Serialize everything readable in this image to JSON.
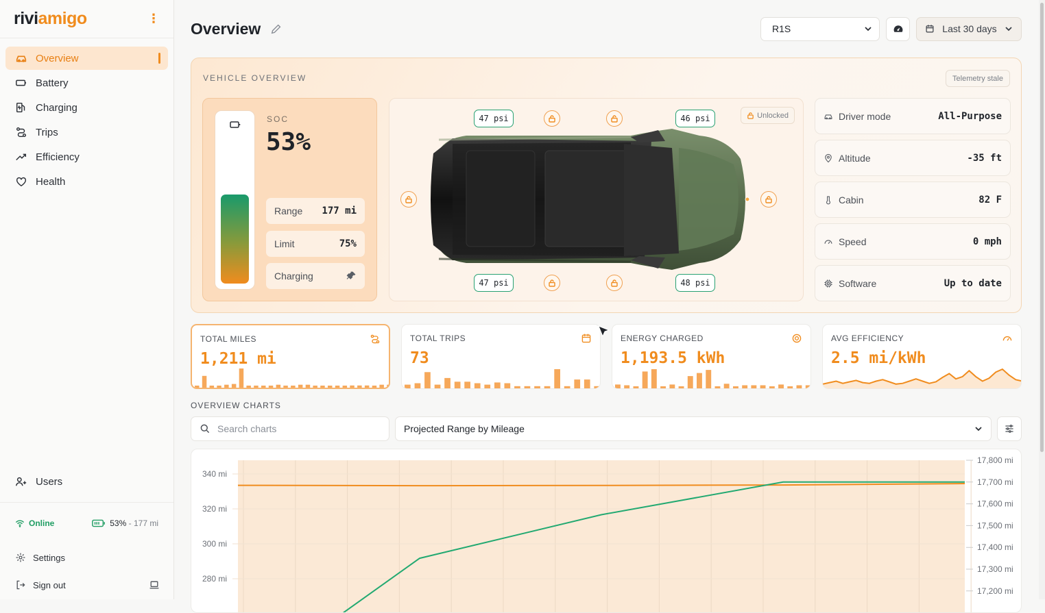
{
  "app": {
    "logo_a": "rivi",
    "logo_b": "amigo"
  },
  "sidebar": {
    "items": [
      {
        "label": "Overview",
        "icon": "car-icon"
      },
      {
        "label": "Battery",
        "icon": "battery-icon"
      },
      {
        "label": "Charging",
        "icon": "fuel-pump-icon"
      },
      {
        "label": "Trips",
        "icon": "route-icon"
      },
      {
        "label": "Efficiency",
        "icon": "trend-up-icon"
      },
      {
        "label": "Health",
        "icon": "heart-icon"
      }
    ],
    "users_label": "Users",
    "status": {
      "online": "Online",
      "soc": "53%",
      "sep": "-",
      "range": "177 mi"
    },
    "settings_label": "Settings",
    "signout_label": "Sign out"
  },
  "header": {
    "title": "Overview",
    "vehicle": "R1S",
    "date_range": "Last 30 days"
  },
  "vehicle_overview": {
    "title": "VEHICLE OVERVIEW",
    "telemetry": "Telemetry stale",
    "soc_label": "SOC",
    "soc_value": "53%",
    "soc_level": 0.53,
    "range_label": "Range",
    "range_value": "177 mi",
    "limit_label": "Limit",
    "limit_value": "75%",
    "charging_label": "Charging",
    "tires": {
      "front_left": "47 psi",
      "front_right": "46 psi",
      "rear_left": "47 psi",
      "rear_right": "48 psi"
    },
    "lock_status": "Unlocked",
    "info": [
      {
        "label": "Driver mode",
        "value": "All-Purpose",
        "icon": "car-small-icon"
      },
      {
        "label": "Altitude",
        "value": "-35 ft",
        "icon": "pin-icon"
      },
      {
        "label": "Cabin",
        "value": "82 F",
        "icon": "thermometer-icon"
      },
      {
        "label": "Speed",
        "value": "0 mph",
        "icon": "gauge-icon"
      },
      {
        "label": "Software",
        "value": "Up to date",
        "icon": "chip-icon"
      }
    ]
  },
  "kpis": [
    {
      "label": "TOTAL MILES",
      "value": "1,211 mi",
      "icon": "route-icon",
      "spark": [
        0,
        0,
        0,
        0,
        0,
        0,
        0,
        0,
        0,
        0,
        0,
        0,
        0,
        0,
        0,
        0,
        0,
        0,
        0,
        0,
        0,
        0,
        0,
        0,
        0,
        0,
        0,
        0,
        0,
        0,
        0,
        0,
        0,
        0
      ]
    },
    {
      "label": "TOTAL TRIPS",
      "value": "73",
      "icon": "calendar-icon"
    },
    {
      "label": "ENERGY CHARGED",
      "value": "1,193.5 kWh",
      "icon": "target-icon"
    },
    {
      "label": "AVG EFFICIENCY",
      "value": "2.5 mi/kWh",
      "icon": "gauge-icon"
    }
  ],
  "kpi_sparks": {
    "miles": [
      0,
      16,
      0,
      0,
      4,
      5,
      26,
      0,
      0,
      0,
      0,
      4,
      0,
      0,
      4,
      4,
      0,
      0,
      0,
      0,
      0,
      3,
      3,
      3,
      0,
      4,
      4
    ],
    "trips": [
      5,
      7,
      22,
      5,
      14,
      9,
      9,
      7,
      5,
      8,
      7,
      3,
      3,
      3,
      3,
      26,
      3,
      12,
      12,
      3
    ],
    "energy": [
      5,
      4,
      0,
      22,
      25,
      0,
      5,
      0,
      16,
      20,
      24,
      0,
      6,
      0,
      4,
      4,
      4,
      0,
      5,
      0,
      4,
      4
    ],
    "efficiency": [
      2,
      4,
      6,
      3,
      5,
      7,
      4,
      3,
      6,
      8,
      5,
      2,
      3,
      6,
      9,
      6,
      3,
      5,
      11,
      16,
      9,
      12,
      20,
      12,
      6,
      10,
      18,
      22,
      14,
      8,
      6
    ]
  },
  "charts": {
    "section_title": "OVERVIEW CHARTS",
    "search_placeholder": "Search charts",
    "selected_chart": "Projected Range by Mileage"
  },
  "chart_data": {
    "type": "line",
    "left_axis_ticks": [
      "340 mi",
      "320 mi",
      "300 mi",
      "280 mi"
    ],
    "right_axis_ticks": [
      "17,800 mi",
      "17,700 mi",
      "17,600 mi",
      "17,500 mi",
      "17,400 mi",
      "17,300 mi",
      "17,200 mi"
    ],
    "series": [
      {
        "color": "#f08c1e",
        "axis": "left",
        "points": [
          [
            0,
            333.5
          ],
          [
            0.25,
            333.3
          ],
          [
            0.5,
            333.4
          ],
          [
            0.75,
            333.7
          ],
          [
            1,
            334.5
          ]
        ]
      },
      {
        "color": "#22a971",
        "axis": "right",
        "points": [
          [
            0.145,
            17100
          ],
          [
            0.25,
            17350
          ],
          [
            0.5,
            17550
          ],
          [
            0.75,
            17700
          ],
          [
            1,
            17700
          ]
        ]
      }
    ],
    "grid": true
  },
  "colors": {
    "accent": "#f08c1e",
    "green": "#1f9d63"
  }
}
